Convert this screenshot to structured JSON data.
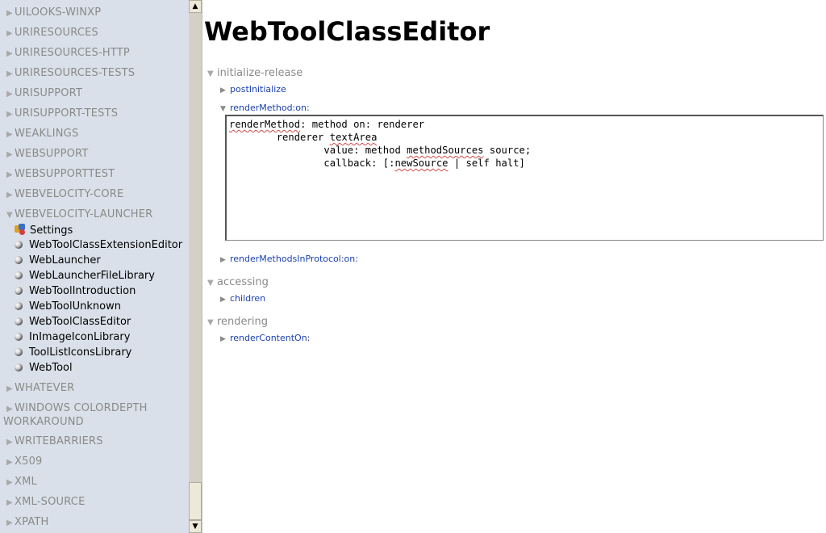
{
  "sidebar": {
    "packages_top": [
      {
        "label": "UILOOKS-WINXP"
      },
      {
        "label": "URIRESOURCES"
      },
      {
        "label": "URIRESOURCES-HTTP"
      },
      {
        "label": "URIRESOURCES-TESTS"
      },
      {
        "label": "URISUPPORT"
      },
      {
        "label": "URISUPPORT-TESTS"
      },
      {
        "label": "WEAKLINGS"
      },
      {
        "label": "WEBSUPPORT"
      },
      {
        "label": "WEBSUPPORTTEST"
      },
      {
        "label": "WEBVELOCITY-CORE"
      }
    ],
    "open_package": {
      "label": "WEBVELOCITY-LAUNCHER"
    },
    "classes": [
      {
        "label": "Settings",
        "icon": "settings-icon"
      },
      {
        "label": "WebToolClassExtensionEditor"
      },
      {
        "label": "WebLauncher"
      },
      {
        "label": "WebLauncherFileLibrary"
      },
      {
        "label": "WebToolIntroduction"
      },
      {
        "label": "WebToolUnknown"
      },
      {
        "label": "WebToolClassEditor"
      },
      {
        "label": "InImageIconLibrary"
      },
      {
        "label": "ToolListIconsLibrary"
      },
      {
        "label": "WebTool"
      }
    ],
    "packages_bottom": [
      {
        "label": "WHATEVER"
      },
      {
        "label": "WINDOWS COLORDEPTH WORKAROUND"
      },
      {
        "label": "WRITEBARRIERS"
      },
      {
        "label": "X509"
      },
      {
        "label": "XML"
      },
      {
        "label": "XML-SOURCE"
      },
      {
        "label": "XPATH"
      }
    ]
  },
  "main": {
    "title": "WebToolClassEditor",
    "protocols": [
      {
        "label": "initialize-release"
      },
      {
        "label": "accessing"
      },
      {
        "label": "rendering"
      }
    ],
    "methods": {
      "postInitialize": "postInitialize",
      "renderMethodOn": "renderMethod:on:",
      "renderMethodsInProtocolOn": "renderMethodsInProtocol:on:",
      "children": "children",
      "renderContentOn": "renderContentOn:"
    },
    "code": {
      "l1_a": "renderMethod",
      "l1_b": ": method on: renderer",
      "l2_a": "        renderer ",
      "l2_b": "textArea",
      "l3_a": "                value: method ",
      "l3_b": "methodSources",
      "l3_c": " source;",
      "l4_a": "                callback: [:",
      "l4_b": "newSource",
      "l4_c": " | self halt]"
    }
  },
  "colors": {
    "sidebar_bg": "#d9e0e9",
    "link": "#1a3fb0",
    "muted": "#8a8a8a"
  }
}
